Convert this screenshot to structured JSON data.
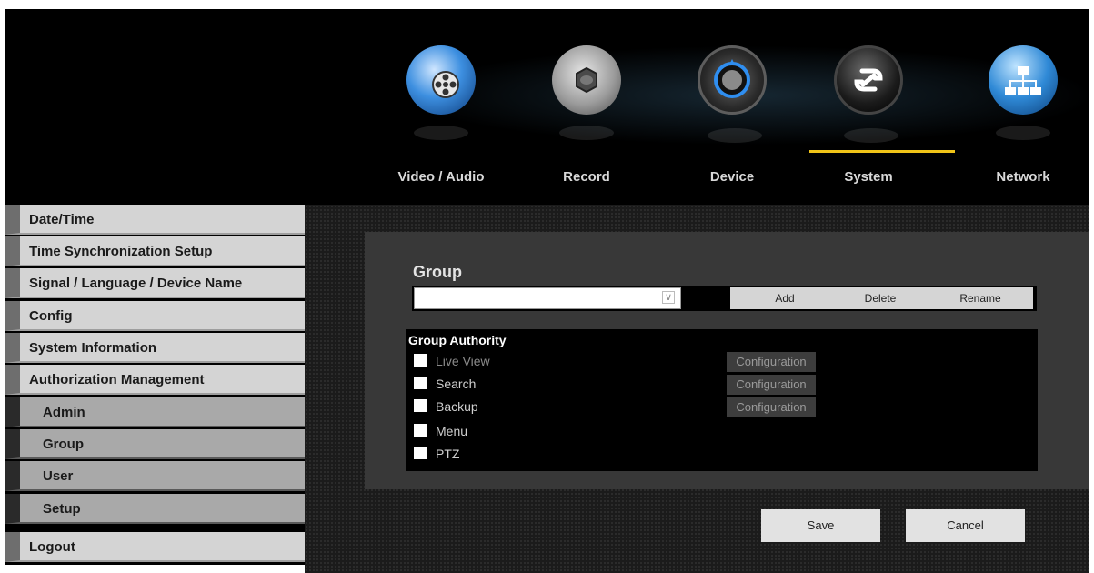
{
  "nav": {
    "tabs": [
      {
        "label": "Video / Audio",
        "icon": "video-audio-icon"
      },
      {
        "label": "Record",
        "icon": "record-icon"
      },
      {
        "label": "Device",
        "icon": "device-icon"
      },
      {
        "label": "System",
        "icon": "system-icon",
        "active": true
      },
      {
        "label": "Network",
        "icon": "network-icon"
      }
    ],
    "active_color": "#f0c418"
  },
  "sidebar": {
    "items": [
      {
        "label": "Date/Time"
      },
      {
        "label": "Time Synchronization Setup"
      },
      {
        "label": "Signal / Language / Device Name"
      },
      {
        "label": "Config"
      },
      {
        "label": "System Information"
      },
      {
        "label": "Authorization Management"
      }
    ],
    "subitems": [
      {
        "label": "Admin"
      },
      {
        "label": "Group"
      },
      {
        "label": "User"
      },
      {
        "label": "Setup"
      }
    ],
    "logout": "Logout"
  },
  "group": {
    "title": "Group",
    "selected_value": "",
    "buttons": {
      "add": "Add",
      "delete": "Delete",
      "rename": "Rename"
    }
  },
  "authority": {
    "title": "Group Authority",
    "items": [
      {
        "label": "Live View",
        "checked": false,
        "config": "Configuration"
      },
      {
        "label": "Search",
        "checked": false,
        "config": "Configuration"
      },
      {
        "label": "Backup",
        "checked": false,
        "config": "Configuration"
      },
      {
        "label": "Menu",
        "checked": false
      },
      {
        "label": "PTZ",
        "checked": false
      }
    ]
  },
  "actions": {
    "save": "Save",
    "cancel": "Cancel"
  }
}
